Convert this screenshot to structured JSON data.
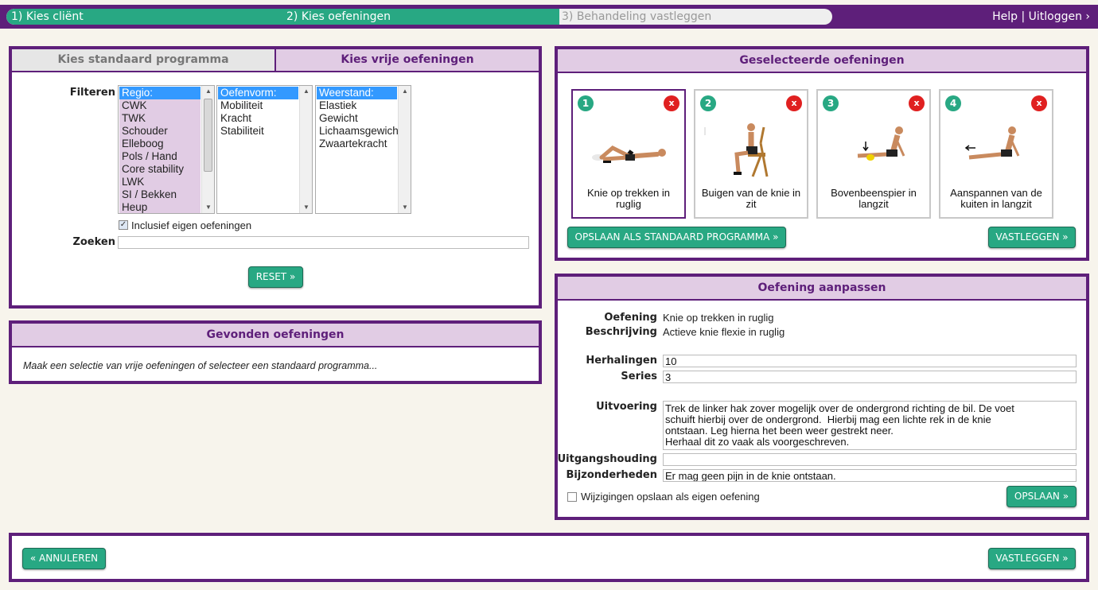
{
  "wizard": {
    "step1": "1) Kies cliënt",
    "step2": "2) Kies oefeningen",
    "step3": "3) Behandeling vastleggen",
    "help": "Help",
    "separator": "|",
    "logout": "Uitloggen ›",
    "progress_fraction": 0.67
  },
  "filter_panel": {
    "tab_standard": "Kies standaard programma",
    "tab_free": "Kies vrije oefeningen",
    "filter_label": "Filteren",
    "regio": [
      "Regio:",
      "CWK",
      "TWK",
      "Schouder",
      "Elleboog",
      "Pols / Hand",
      "Core stability",
      "LWK",
      "SI / Bekken",
      "Heup"
    ],
    "oefenvorm": [
      "Oefenvorm:",
      "Mobiliteit",
      "Kracht",
      "Stabiliteit"
    ],
    "weerstand": [
      "Weerstand:",
      "Elastiek",
      "Gewicht",
      "Lichaamsgewicht",
      "Zwaartekracht"
    ],
    "include_own_label": "Inclusief eigen oefeningen",
    "include_own_checked": true,
    "search_label": "Zoeken",
    "search_value": "",
    "reset_button": "RESET »"
  },
  "found_panel": {
    "title": "Gevonden oefeningen",
    "message": "Maak een selectie van vrije oefeningen of selecteer een standaard programma..."
  },
  "selected_panel": {
    "title": "Geselecteerde oefeningen",
    "remove_glyph": "x",
    "exercises": [
      {
        "number": "1",
        "label": "Knie op trekken in ruglig",
        "icon": "exercise-supine-knee-icon"
      },
      {
        "number": "2",
        "label": "Buigen van de knie in zit",
        "icon": "exercise-seated-knee-icon"
      },
      {
        "number": "3",
        "label": "Bovenbeenspier in langzit",
        "icon": "exercise-longsit-quad-icon"
      },
      {
        "number": "4",
        "label": "Aanspannen van de kuiten in langzit",
        "icon": "exercise-longsit-calf-icon"
      }
    ],
    "save_standard_button": "OPSLAAN ALS STANDAARD PROGRAMMA »",
    "finalize_button": "VASTLEGGEN »"
  },
  "edit_panel": {
    "title": "Oefening aanpassen",
    "exercise_label": "Oefening",
    "exercise_value": "Knie op trekken in ruglig",
    "description_label": "Beschrijving",
    "description_value": "Actieve knie flexie in ruglig",
    "reps_label": "Herhalingen",
    "reps_value": "10",
    "series_label": "Series",
    "series_value": "3",
    "execution_label": "Uitvoering",
    "execution_value": "Trek de linker hak zover mogelijk over de ondergrond richting de bil. De voet\nschuift hierbij over de ondergrond.  Hierbij mag een lichte rek in de knie\nontstaan. Leg hierna het been weer gestrekt neer.\nHerhaal dit zo vaak als voorgeschreven.",
    "start_position_label": "Uitgangshouding",
    "start_position_value": "",
    "particulars_label": "Bijzonderheden",
    "particulars_value": "Er mag geen pijn in de knie ontstaan.",
    "save_own_label": "Wijzigingen opslaan als eigen oefening",
    "save_own_checked": false,
    "save_button": "OPSLAAN »"
  },
  "footer": {
    "cancel_button": "« ANNULEREN",
    "finalize_button": "VASTLEGGEN »"
  },
  "colors": {
    "brand_purple": "#5e1f7a",
    "accent_green": "#28a883",
    "header_lilac": "#e1cce4",
    "remove_red": "#e02020"
  }
}
